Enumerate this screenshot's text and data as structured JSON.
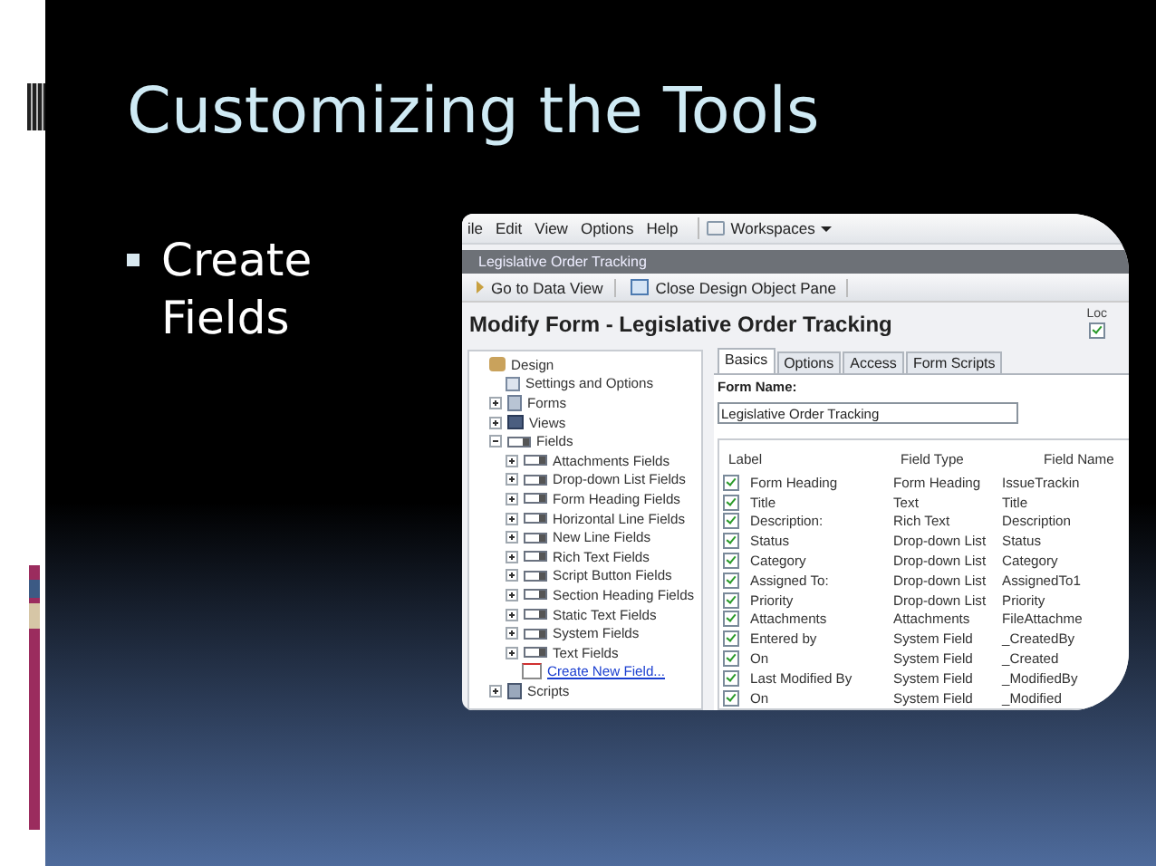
{
  "slide": {
    "title": "Customizing the Tools",
    "bullets": [
      "Create Fields"
    ]
  },
  "screenshot": {
    "menu": [
      "ile",
      "Edit",
      "View",
      "Options",
      "Help"
    ],
    "workspaces": "Workspaces",
    "window_title": "Legislative Order Tracking",
    "toolbar": [
      {
        "kind": "data",
        "label": "Go to Data View"
      },
      {
        "kind": "pane",
        "label": "Close Design Object Pane"
      }
    ],
    "heading": "Modify Form - Legislative Order Tracking",
    "lock": {
      "label": "Loc",
      "checked": true
    },
    "tree": [
      {
        "kind": "design",
        "label": "Design",
        "children": [
          {
            "kind": "settings",
            "label": "Settings and Options"
          },
          {
            "kind": "forms",
            "label": "Forms",
            "expanded": false
          },
          {
            "kind": "views",
            "label": "Views",
            "expanded": false
          },
          {
            "kind": "field",
            "label": "Fields",
            "expanded": true,
            "children": [
              {
                "kind": "field",
                "label": "Attachments Fields",
                "expanded": false
              },
              {
                "kind": "field",
                "label": "Drop-down List Fields",
                "expanded": false
              },
              {
                "kind": "field",
                "label": "Form Heading Fields",
                "expanded": false
              },
              {
                "kind": "field",
                "label": "Horizontal Line Fields",
                "expanded": false
              },
              {
                "kind": "field",
                "label": "New Line Fields",
                "expanded": false
              },
              {
                "kind": "field",
                "label": "Rich Text Fields",
                "expanded": false
              },
              {
                "kind": "field",
                "label": "Script Button Fields",
                "expanded": false
              },
              {
                "kind": "field",
                "label": "Section Heading Fields",
                "expanded": false
              },
              {
                "kind": "field",
                "label": "Static Text Fields",
                "expanded": false
              },
              {
                "kind": "field",
                "label": "System Fields",
                "expanded": false
              },
              {
                "kind": "field",
                "label": "Text Fields",
                "expanded": false
              },
              {
                "kind": "link",
                "label": "Create New Field..."
              }
            ]
          },
          {
            "kind": "scripts",
            "label": "Scripts",
            "expanded": false
          }
        ]
      }
    ],
    "tabs": [
      {
        "label": "Basics",
        "selected": true
      },
      {
        "label": "Options",
        "selected": false
      },
      {
        "label": "Access",
        "selected": false
      },
      {
        "label": "Form Scripts",
        "selected": false
      }
    ],
    "form_name": {
      "label": "Form Name:",
      "value": "Legislative Order Tracking"
    },
    "table": {
      "columns": [
        "Label",
        "Field Type",
        "Field Name"
      ],
      "rows": [
        {
          "checked": true,
          "cells": [
            "Form Heading",
            "Form Heading",
            "IssueTrackin"
          ]
        },
        {
          "checked": true,
          "cells": [
            "Title",
            "Text",
            "Title"
          ]
        },
        {
          "checked": true,
          "cells": [
            "Description:",
            "Rich Text",
            "Description"
          ]
        },
        {
          "checked": true,
          "cells": [
            "Status",
            "Drop-down List",
            "Status"
          ]
        },
        {
          "checked": true,
          "cells": [
            "Category",
            "Drop-down List",
            "Category"
          ]
        },
        {
          "checked": true,
          "cells": [
            "Assigned To:",
            "Drop-down List",
            "AssignedTo1"
          ]
        },
        {
          "checked": true,
          "cells": [
            "Priority",
            "Drop-down List",
            "Priority"
          ]
        },
        {
          "checked": true,
          "cells": [
            "Attachments",
            "Attachments",
            "FileAttachme"
          ]
        },
        {
          "checked": true,
          "cells": [
            "Entered by",
            "System Field",
            "_CreatedBy"
          ]
        },
        {
          "checked": true,
          "cells": [
            "On",
            "System Field",
            "_Created"
          ]
        },
        {
          "checked": true,
          "cells": [
            "Last Modified By",
            "System Field",
            "_ModifiedBy"
          ]
        },
        {
          "checked": true,
          "cells": [
            "On",
            "System Field",
            "_Modified"
          ]
        }
      ]
    }
  }
}
